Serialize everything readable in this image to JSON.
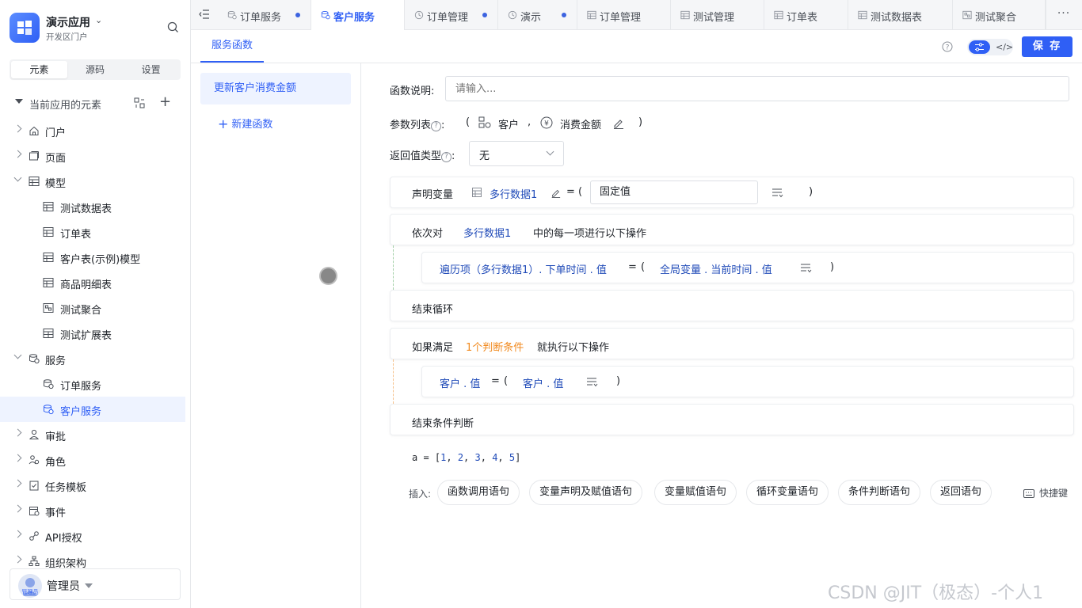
{
  "app": {
    "name": "演示应用",
    "subtitle": "开发区门户",
    "logo_color": "#2f5ff5"
  },
  "sidebar": {
    "tabs": [
      {
        "label": "元素",
        "active": true
      },
      {
        "label": "源码",
        "active": false
      },
      {
        "label": "设置",
        "active": false
      }
    ],
    "section_title": "当前应用的元素",
    "tree": [
      {
        "label": "门户",
        "level": 1,
        "icon": "home-icon",
        "expanded": false
      },
      {
        "label": "页面",
        "level": 1,
        "icon": "page-icon",
        "expanded": false
      },
      {
        "label": "模型",
        "level": 1,
        "icon": "table-icon",
        "expanded": true
      },
      {
        "label": "测试数据表",
        "level": 2,
        "icon": "table-icon"
      },
      {
        "label": "订单表",
        "level": 2,
        "icon": "table-icon"
      },
      {
        "label": "客户表(示例)模型",
        "level": 2,
        "icon": "table-icon"
      },
      {
        "label": "商品明细表",
        "level": 2,
        "icon": "table-icon"
      },
      {
        "label": "测试聚合",
        "level": 2,
        "icon": "aggregate-icon"
      },
      {
        "label": "测试扩展表",
        "level": 2,
        "icon": "extend-table-icon"
      },
      {
        "label": "服务",
        "level": 1,
        "icon": "service-icon",
        "expanded": true
      },
      {
        "label": "订单服务",
        "level": 2,
        "icon": "service-icon"
      },
      {
        "label": "客户服务",
        "level": 2,
        "icon": "service-icon",
        "active": true
      },
      {
        "label": "审批",
        "level": 1,
        "icon": "approval-icon",
        "expanded": false
      },
      {
        "label": "角色",
        "level": 1,
        "icon": "role-icon",
        "expanded": false
      },
      {
        "label": "任务模板",
        "level": 1,
        "icon": "task-icon",
        "expanded": false
      },
      {
        "label": "事件",
        "level": 1,
        "icon": "event-icon",
        "expanded": false
      },
      {
        "label": "API授权",
        "level": 1,
        "icon": "api-icon",
        "expanded": false
      },
      {
        "label": "组织架构",
        "level": 1,
        "icon": "org-icon",
        "expanded": false
      }
    ],
    "user": {
      "name": "管理员",
      "avatar_label": "管理员"
    }
  },
  "tabs": [
    {
      "label": "订单服务",
      "icon": "service-icon",
      "dot": true,
      "active": false
    },
    {
      "label": "客户服务",
      "icon": "service-icon",
      "dot": false,
      "active": true
    },
    {
      "label": "订单管理",
      "icon": "manage-icon",
      "dot": true,
      "active": false
    },
    {
      "label": "演示",
      "icon": "manage-icon",
      "dot": true,
      "active": false
    },
    {
      "label": "订单管理",
      "icon": "table-icon",
      "dot": false,
      "active": false
    },
    {
      "label": "测试管理",
      "icon": "table-icon",
      "dot": false,
      "active": false
    },
    {
      "label": "订单表",
      "icon": "table-icon",
      "dot": false,
      "active": false
    },
    {
      "label": "测试数据表",
      "icon": "table-icon",
      "dot": false,
      "active": false
    },
    {
      "label": "测试聚合",
      "icon": "aggregate-icon",
      "dot": false,
      "active": false
    }
  ],
  "more_label": "···",
  "subheader": {
    "tab_label": "服务函数",
    "save_label": "保 存",
    "toggle_off_label": "</>"
  },
  "functions": {
    "items": [
      "更新客户消费金额"
    ],
    "new_label": "新建函数"
  },
  "editor": {
    "desc_label": "函数说明:",
    "desc_placeholder": "请输入...",
    "params_label": "参数列表",
    "params_colon": ":",
    "paren_open": "(",
    "paren_close": ")",
    "comma": ",",
    "params": [
      "客户",
      "消费金额"
    ],
    "return_label": "返回值类型",
    "return_value": "无",
    "qmark": "?",
    "declare": {
      "keyword": "声明变量",
      "var": "多行数据1",
      "eq": "=",
      "paren_open": "(",
      "paren_close": ")",
      "value": "固定值"
    },
    "loop": {
      "prefix": "依次对",
      "var": "多行数据1",
      "suffix": "中的每一项进行以下操作"
    },
    "loop_assign": {
      "left": "遍历项（多行数据1）. 下单时间 . 值",
      "eq": "=",
      "paren_open": "(",
      "right": "全局变量 . 当前时间 . 值",
      "paren_close": ")"
    },
    "loop_end": "结束循环",
    "cond": {
      "prefix": "如果满足",
      "count": "1个判断条件",
      "suffix": "就执行以下操作"
    },
    "cond_assign": {
      "left": "客户 . 值",
      "eq": "=",
      "paren_open": "(",
      "right": "客户 . 值",
      "paren_close": ")"
    },
    "cond_end": "结束条件判断",
    "code": {
      "prefix": "a = [",
      "nums": [
        "1",
        "2",
        "3",
        "4",
        "5"
      ],
      "sep": ", ",
      "suffix": "]"
    },
    "insert_label": "插入:",
    "insert_chips": [
      "函数调用语句",
      "变量声明及赋值语句",
      "变量赋值语句",
      "循环变量语句",
      "条件判断语句",
      "返回语句"
    ],
    "shortcut_label": "快捷键"
  },
  "watermark": "CSDN @JIT（极态）-个人1",
  "colors": {
    "primary": "#2f5ff5",
    "keyword_blue": "#1f4ab8",
    "condition_orange": "#f18a1f"
  }
}
